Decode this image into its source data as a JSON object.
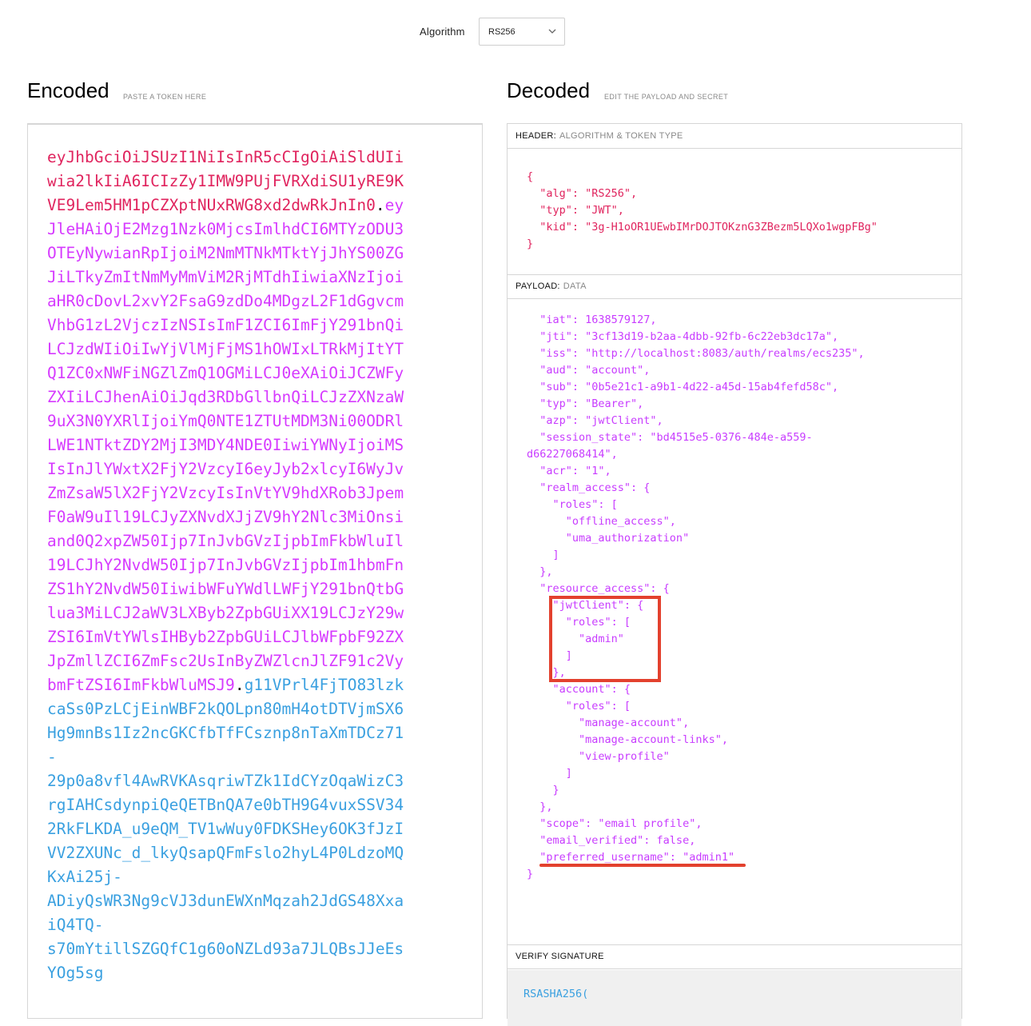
{
  "algorithm": {
    "label": "Algorithm",
    "selected": "RS256"
  },
  "encoded": {
    "title": "Encoded",
    "subtitle": "PASTE A TOKEN HERE",
    "token_lines": [
      [
        {
          "t": "h",
          "v": "eyJhbGciOiJSUzI1NiIsInR5cCIgOiAiSldUIi"
        }
      ],
      [
        {
          "t": "h",
          "v": "wia2lkIiA6ICIzZy1IMW9PUjFVRXdiSU1yRE9K"
        }
      ],
      [
        {
          "t": "h",
          "v": "VE9Lem5HM1pCZXptNUxRWG8xd2dwRkJnIn0"
        },
        {
          "t": "dot",
          "v": "."
        },
        {
          "t": "p",
          "v": "ey"
        }
      ],
      [
        {
          "t": "p",
          "v": "JleHAiOjE2Mzg1Nzk0MjcsImlhdCI6MTYzODU3"
        }
      ],
      [
        {
          "t": "p",
          "v": "OTEyNywianRpIjoiM2NmMTNkMTktYjJhYS00ZG"
        }
      ],
      [
        {
          "t": "p",
          "v": "JiLTkyZmItNmMyMmViM2RjMTdhIiwiaXNzIjoi"
        }
      ],
      [
        {
          "t": "p",
          "v": "aHR0cDovL2xvY2FsaG9zdDo4MDgzL2F1dGgvcm"
        }
      ],
      [
        {
          "t": "p",
          "v": "VhbG1zL2VjczIzNSIsImF1ZCI6ImFjY291bnQi"
        }
      ],
      [
        {
          "t": "p",
          "v": "LCJzdWIiOiIwYjVlMjFjMS1hOWIxLTRkMjItYT"
        }
      ],
      [
        {
          "t": "p",
          "v": "Q1ZC0xNWFiNGZlZmQ1OGMiLCJ0eXAiOiJCZWFy"
        }
      ],
      [
        {
          "t": "p",
          "v": "ZXIiLCJhenAiOiJqd3RDbGllbnQiLCJzZXNzaW"
        }
      ],
      [
        {
          "t": "p",
          "v": "9uX3N0YXRlIjoiYmQ0NTE1ZTUtMDM3Ni00ODRl"
        }
      ],
      [
        {
          "t": "p",
          "v": "LWE1NTktZDY2MjI3MDY4NDE0IiwiYWNyIjoiMS"
        }
      ],
      [
        {
          "t": "p",
          "v": "IsInJlYWxtX2FjY2VzcyI6eyJyb2xlcyI6WyJv"
        }
      ],
      [
        {
          "t": "p",
          "v": "ZmZsaW5lX2FjY2VzcyIsInVtYV9hdXRob3Jpem"
        }
      ],
      [
        {
          "t": "p",
          "v": "F0aW9uIl19LCJyZXNvdXJjZV9hY2Nlc3MiOnsi"
        }
      ],
      [
        {
          "t": "p",
          "v": "and0Q2xpZW50Ijp7InJvbGVzIjpbImFkbWluIl"
        }
      ],
      [
        {
          "t": "p",
          "v": "19LCJhY2NvdW50Ijp7InJvbGVzIjpbIm1hbmFn"
        }
      ],
      [
        {
          "t": "p",
          "v": "ZS1hY2NvdW50IiwibWFuYWdlLWFjY291bnQtbG"
        }
      ],
      [
        {
          "t": "p",
          "v": "lua3MiLCJ2aWV3LXByb2ZpbGUiXX19LCJzY29w"
        }
      ],
      [
        {
          "t": "p",
          "v": "ZSI6ImVtYWlsIHByb2ZpbGUiLCJlbWFpbF92ZX"
        }
      ],
      [
        {
          "t": "p",
          "v": "JpZmllZCI6ZmFsc2UsInByZWZlcnJlZF91c2Vy"
        }
      ],
      [
        {
          "t": "p",
          "v": "bmFtZSI6ImFkbWluMSJ9"
        },
        {
          "t": "dot",
          "v": "."
        },
        {
          "t": "s",
          "v": "g11VPrl4FjTO83lzk"
        }
      ],
      [
        {
          "t": "s",
          "v": "caSs0PzLCjEinWBF2kQOLpn80mH4otDTVjmSX6"
        }
      ],
      [
        {
          "t": "s",
          "v": "Hg9mnBs1Iz2ncGKCfbTfFCsznp8nTaXmTDCz71"
        }
      ],
      [
        {
          "t": "s",
          "v": "-"
        }
      ],
      [
        {
          "t": "s",
          "v": "29p0a8vfl4AwRVKAsqriwTZk1IdCYzOqaWizC3"
        }
      ],
      [
        {
          "t": "s",
          "v": "rgIAHCsdynpiQeQETBnQA7e0bTH9G4vuxSSV34"
        }
      ],
      [
        {
          "t": "s",
          "v": "2RkFLKDA_u9eQM_TV1wWuy0FDKSHey6OK3fJzI"
        }
      ],
      [
        {
          "t": "s",
          "v": "VV2ZXUNc_d_lkyQsapQFmFslo2hyL4P0LdzoMQ"
        }
      ],
      [
        {
          "t": "s",
          "v": "KxAi25j-"
        }
      ],
      [
        {
          "t": "s",
          "v": "ADiyQsWR3Ng9cVJ3dunEWXnMqzah2JdGS48Xxa"
        }
      ],
      [
        {
          "t": "s",
          "v": "iQ4TQ-"
        }
      ],
      [
        {
          "t": "s",
          "v": "s70mYtillSZGQfC1g60oNZLd93a7JLQBsJJeEs"
        }
      ],
      [
        {
          "t": "s",
          "v": "YOg5sg"
        }
      ]
    ]
  },
  "decoded": {
    "title": "Decoded",
    "subtitle": "EDIT THE PAYLOAD AND SECRET",
    "header_section": {
      "label": "HEADER:",
      "desc": "ALGORITHM & TOKEN TYPE",
      "lines": [
        "{",
        "  \"alg\": \"RS256\",",
        "  \"typ\": \"JWT\",",
        "  \"kid\": \"3g-H1oOR1UEwbIMrDOJTOKznG3ZBezm5LQXo1wgpFBg\"",
        "}"
      ]
    },
    "payload_section": {
      "label": "PAYLOAD:",
      "desc": "DATA",
      "lines": [
        "  \"iat\": 1638579127,",
        "  \"jti\": \"3cf13d19-b2aa-4dbb-92fb-6c22eb3dc17a\",",
        "  \"iss\": \"http://localhost:8083/auth/realms/ecs235\",",
        "  \"aud\": \"account\",",
        "  \"sub\": \"0b5e21c1-a9b1-4d22-a45d-15ab4fefd58c\",",
        "  \"typ\": \"Bearer\",",
        "  \"azp\": \"jwtClient\",",
        "  \"session_state\": \"bd4515e5-0376-484e-a559-",
        "d66227068414\",",
        "  \"acr\": \"1\",",
        "  \"realm_access\": {",
        "    \"roles\": [",
        "      \"offline_access\",",
        "      \"uma_authorization\"",
        "    ]",
        "  },",
        "  \"resource_access\": {",
        "    \"jwtClient\": {",
        "      \"roles\": [",
        "        \"admin\"",
        "      ]",
        "    },",
        "    \"account\": {",
        "      \"roles\": [",
        "        \"manage-account\",",
        "        \"manage-account-links\",",
        "        \"view-profile\"",
        "      ]",
        "    }",
        "  },",
        "  \"scope\": \"email profile\",",
        "  \"email_verified\": false,",
        "  \"preferred_username\": \"admin1\"",
        "}"
      ]
    },
    "verify_section": {
      "label": "VERIFY SIGNATURE",
      "code": "RSASHA256("
    }
  }
}
